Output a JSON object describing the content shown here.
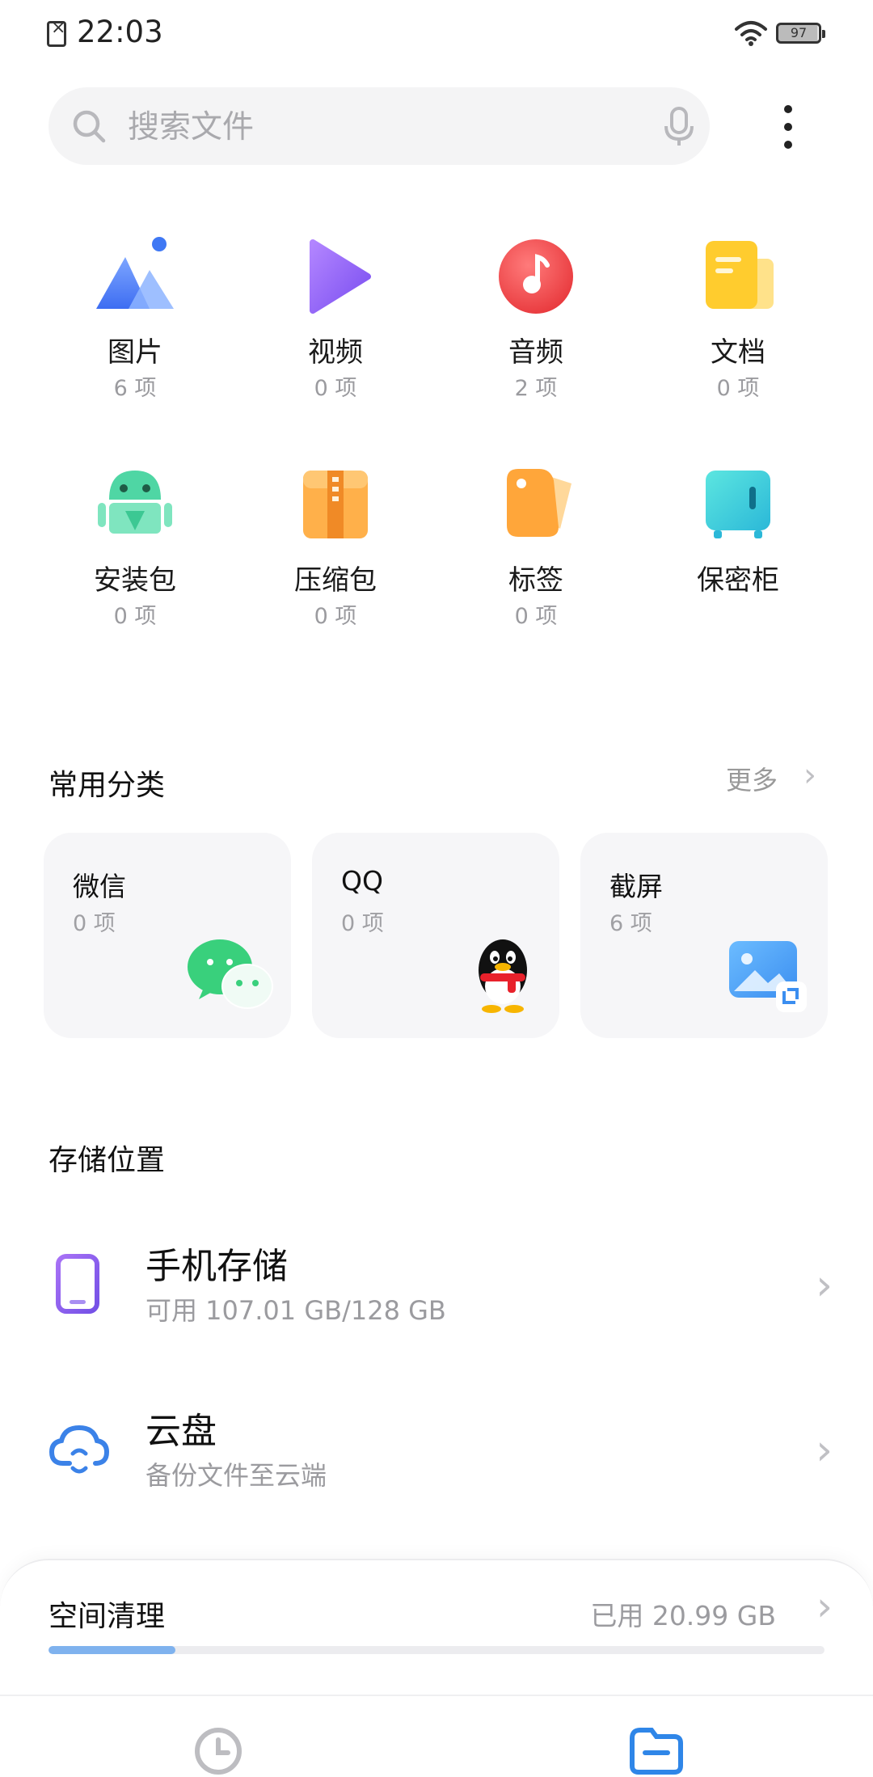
{
  "status_bar": {
    "time": "22:03",
    "battery": "97"
  },
  "search": {
    "placeholder": "搜索文件"
  },
  "categories": [
    {
      "name": "图片",
      "count": "6 项"
    },
    {
      "name": "视频",
      "count": "0 项"
    },
    {
      "name": "音频",
      "count": "2 项"
    },
    {
      "name": "文档",
      "count": "0 项"
    },
    {
      "name": "安装包",
      "count": "0 项"
    },
    {
      "name": "压缩包",
      "count": "0 项"
    },
    {
      "name": "标签",
      "count": "0 项"
    },
    {
      "name": "保密柜",
      "count": ""
    }
  ],
  "common": {
    "title": "常用分类",
    "more": "更多",
    "cards": [
      {
        "title": "微信",
        "count": "0 项"
      },
      {
        "title": "QQ",
        "count": "0 项"
      },
      {
        "title": "截屏",
        "count": "6 项"
      }
    ]
  },
  "storage": {
    "title": "存储位置",
    "items": [
      {
        "title": "手机存储",
        "subtitle": "可用 107.01 GB/128 GB"
      },
      {
        "title": "云盘",
        "subtitle": "备份文件至云端"
      }
    ]
  },
  "cleanup": {
    "title": "空间清理",
    "used": "已用 20.99 GB",
    "used_fraction": 0.164
  },
  "colors": {
    "accent": "#2f86e8",
    "progress": "#7fb2ee"
  },
  "icons": {
    "nav": [
      "recent-clock-icon",
      "browse-folder-icon"
    ]
  }
}
